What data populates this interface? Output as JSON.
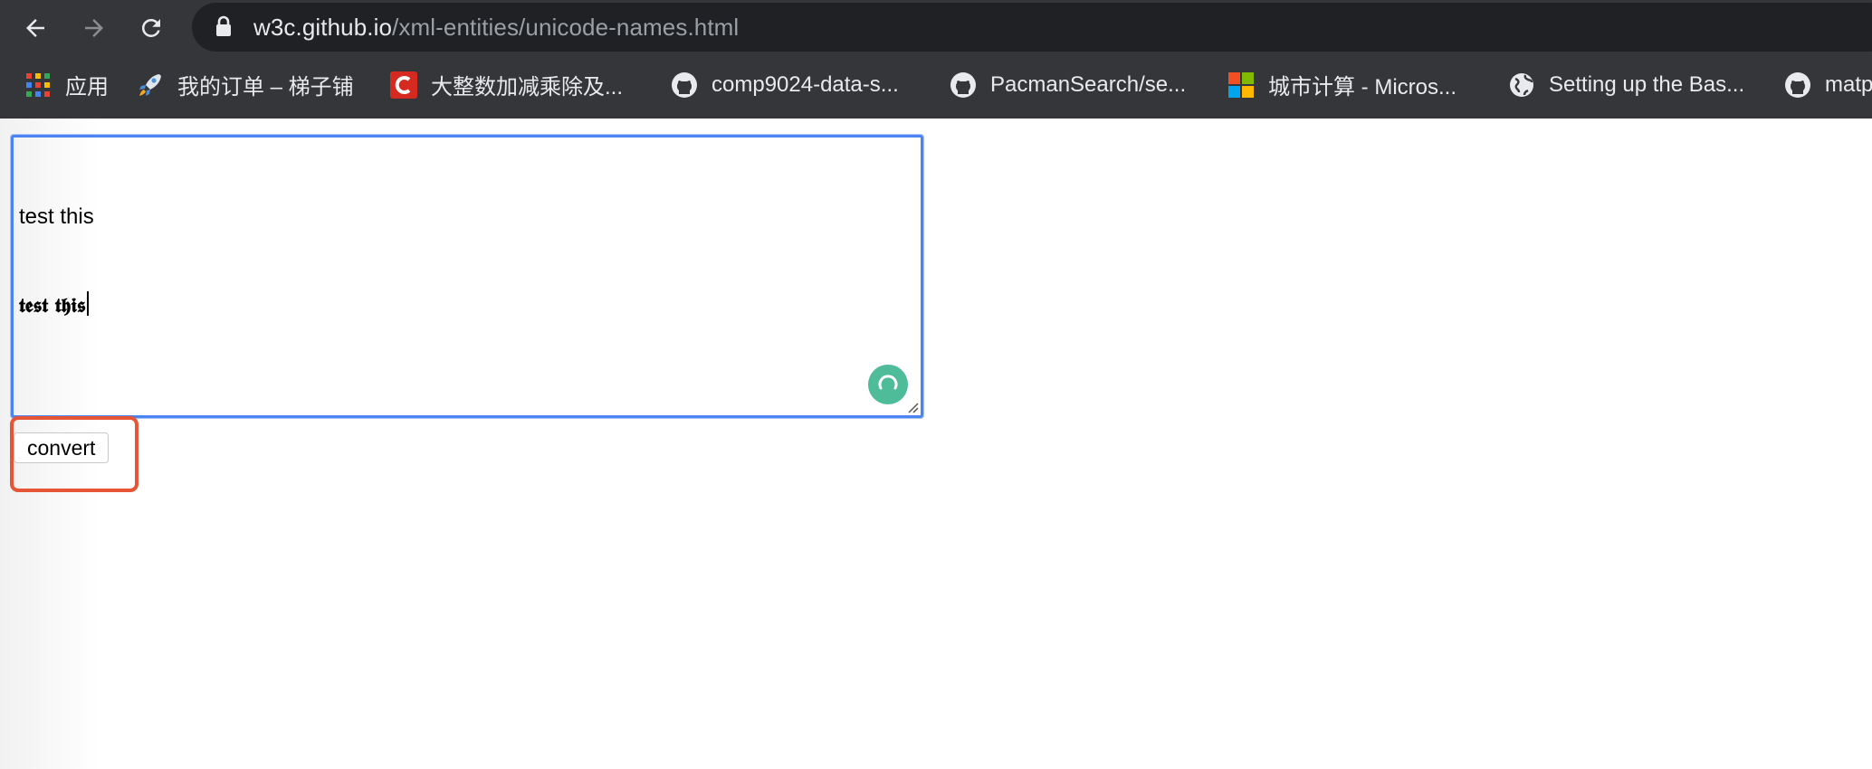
{
  "browser": {
    "url_host": "w3c.github.io",
    "url_path": "/xml-entities/unicode-names.html",
    "bookmarks": [
      {
        "label": "应用",
        "icon": "apps-grid-icon"
      },
      {
        "label": "我的订单 – 梯子铺",
        "icon": "rocket-icon"
      },
      {
        "label": "大整数加减乘除及...",
        "icon": "red-c-icon"
      },
      {
        "label": "comp9024-data-s...",
        "icon": "github-icon"
      },
      {
        "label": "PacmanSearch/se...",
        "icon": "github-icon"
      },
      {
        "label": "城市计算 - Micros...",
        "icon": "microsoft-icon"
      },
      {
        "label": "Setting up the Bas...",
        "icon": "globe-icon"
      },
      {
        "label": "matp",
        "icon": "github-icon"
      }
    ]
  },
  "editor": {
    "line1": "test this",
    "line2": "𝖙𝖊𝖘𝖙 𝖙𝖍𝖎𝖘"
  },
  "form": {
    "convert_label": "convert"
  },
  "colors": {
    "chrome_bg": "#35363a",
    "omnibox_bg": "#202124",
    "focus_border": "#4c84f2",
    "highlight": "#e65535",
    "grammarly": "#3bb58f"
  }
}
